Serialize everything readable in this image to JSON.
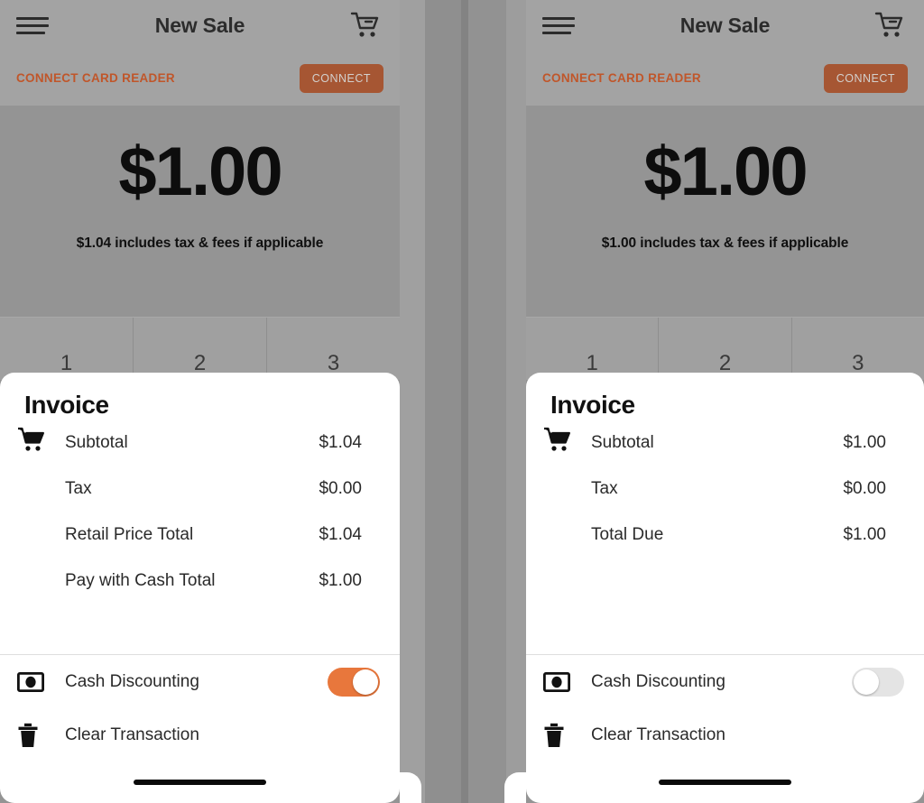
{
  "app": {
    "nav_title": "New Sale",
    "menu_icon": "hamburger-menu-icon",
    "cart_icon": "shopping-cart-remove-icon"
  },
  "colors": {
    "accent_orange": "#c0562a",
    "connect_button_bg": "#a65633",
    "toggle_on": "#e8773c",
    "toggle_off": "#e4e4e4",
    "screen_bg": "#949494",
    "sheet_bg": "#ffffff"
  },
  "card_reader": {
    "label": "CONNECT CARD READER",
    "button_label": "CONNECT"
  },
  "keypad": {
    "keys": [
      "1",
      "2",
      "3"
    ]
  },
  "panels": [
    {
      "id": "cash-discounting-on",
      "amount": "$1.00",
      "amount_note": "$1.04 includes tax & fees if applicable",
      "invoice": {
        "title": "Invoice",
        "icon": "shopping-cart-icon",
        "rows": [
          {
            "label": "Subtotal",
            "value": "$1.04"
          },
          {
            "label": "Tax",
            "value": "$0.00"
          },
          {
            "label": "Retail Price Total",
            "value": "$1.04"
          },
          {
            "label": "Pay with Cash Total",
            "value": "$1.00"
          }
        ]
      },
      "actions": {
        "cash_discounting": {
          "label": "Cash Discounting",
          "icon": "cash-bill-icon",
          "toggle_state": "on"
        },
        "clear_transaction": {
          "label": "Clear Transaction",
          "icon": "trash-icon"
        }
      }
    },
    {
      "id": "cash-discounting-off",
      "amount": "$1.00",
      "amount_note": "$1.00 includes tax & fees if applicable",
      "invoice": {
        "title": "Invoice",
        "icon": "shopping-cart-icon",
        "rows": [
          {
            "label": "Subtotal",
            "value": "$1.00"
          },
          {
            "label": "Tax",
            "value": "$0.00"
          },
          {
            "label": "Total Due",
            "value": "$1.00"
          }
        ]
      },
      "actions": {
        "cash_discounting": {
          "label": "Cash Discounting",
          "icon": "cash-bill-icon",
          "toggle_state": "off"
        },
        "clear_transaction": {
          "label": "Clear Transaction",
          "icon": "trash-icon"
        }
      }
    }
  ]
}
